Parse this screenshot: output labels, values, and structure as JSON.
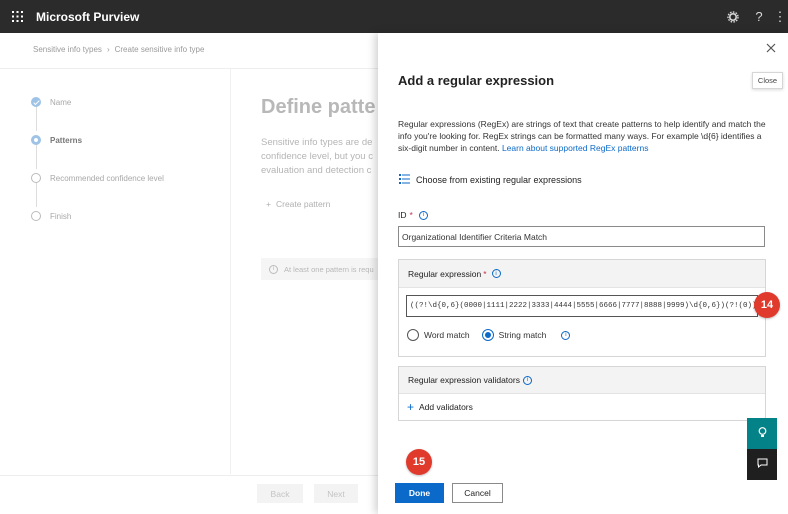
{
  "app": {
    "title": "Microsoft Purview"
  },
  "header": {
    "settings_icon": "gear-icon",
    "help_label": "?",
    "more_label": "⋮"
  },
  "breadcrumb": [
    "Sensitive info types",
    "Create sensitive info type"
  ],
  "steps": [
    {
      "label": "Name",
      "state": "done"
    },
    {
      "label": "Patterns",
      "state": "current"
    },
    {
      "label": "Recommended confidence level",
      "state": "pending"
    },
    {
      "label": "Finish",
      "state": "pending"
    }
  ],
  "background": {
    "title": "Define patte",
    "description_lines": [
      "Sensitive info types are de",
      "confidence level, but you c",
      "evaluation and detection c"
    ],
    "create_pattern": "Create pattern",
    "warning": "At least one pattern is requ",
    "back_label": "Back",
    "next_label": "Next"
  },
  "panel": {
    "title": "Add a regular expression",
    "close_label": "Close",
    "description": "Regular expressions (RegEx) are strings of text that create patterns to help identify and match the info you're looking for. RegEx strings can be formatted many ways. For example \\d{6} identifies a six-digit number in content. ",
    "description_link": "Learn about supported RegEx patterns",
    "choose_existing": "Choose from existing regular expressions",
    "id_label": "ID",
    "id_value": "Organizational Identifier Criteria Match",
    "regex_section_label": "Regular expression",
    "regex_value": "((?!\\d{0,6}(0000|1111|2222|3333|4444|5555|6666|7777|8888|9999)\\d{0,6})(?!(0))[0-9]{9...",
    "word_match_label": "Word match",
    "string_match_label": "String match",
    "selected_match": "String match",
    "validators_label": "Regular expression validators",
    "add_validators_label": "Add validators",
    "done_label": "Done",
    "cancel_label": "Cancel"
  },
  "callouts": {
    "regex_step": "14",
    "done_step": "15"
  },
  "colors": {
    "accent": "#0b6ac9",
    "callout": "#e03a2d",
    "topbar": "#2b2b2b",
    "side_button": "#038387"
  }
}
